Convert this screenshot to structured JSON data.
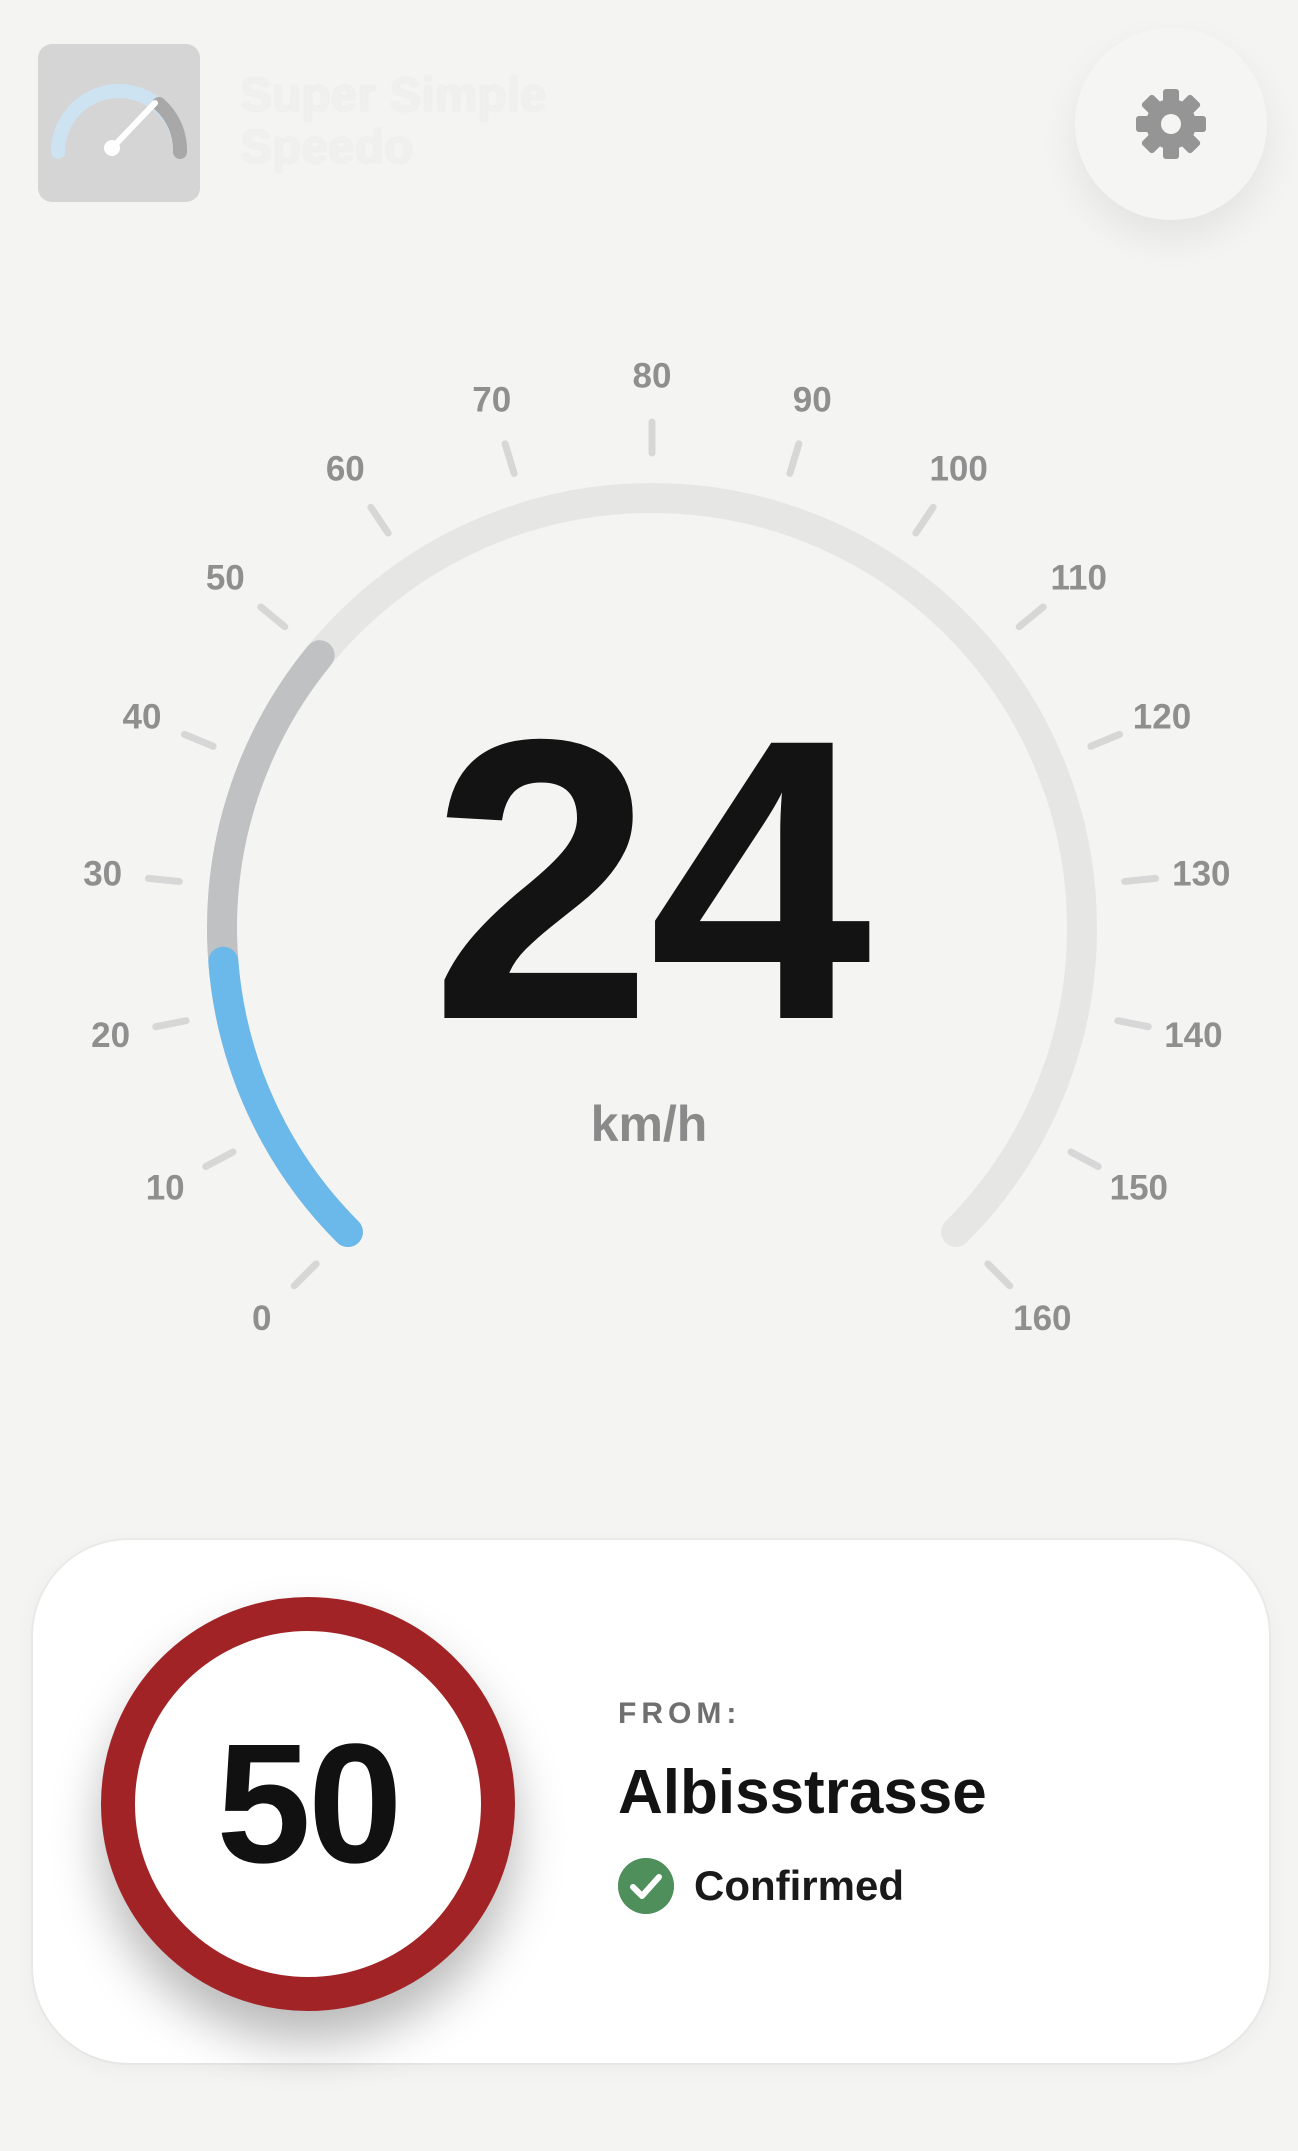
{
  "app": {
    "name": "Super Simple Speedo"
  },
  "speedometer": {
    "speed": 24,
    "unit": "km/h",
    "min": 0,
    "max": 160,
    "tick_labels": [
      "0",
      "10",
      "20",
      "30",
      "40",
      "50",
      "60",
      "70",
      "80",
      "90",
      "100",
      "110",
      "120",
      "130",
      "140",
      "150",
      "160"
    ],
    "speed_limit_arc": 50,
    "colors": {
      "speed_arc": "#6bb8ea",
      "limit_arc": "#c0c1c3",
      "track": "#e6e6e5",
      "tick": "#d7d7d7"
    }
  },
  "speed_limit": {
    "value": "50",
    "from_label": "FROM:",
    "street": "Albisstrasse",
    "status": "Confirmed",
    "colors": {
      "ring": "#a12325",
      "confirmed": "#4f8f5c"
    }
  },
  "icons": {
    "app_icon": "speedometer-icon",
    "settings": "gear-icon",
    "status": "check-icon"
  }
}
